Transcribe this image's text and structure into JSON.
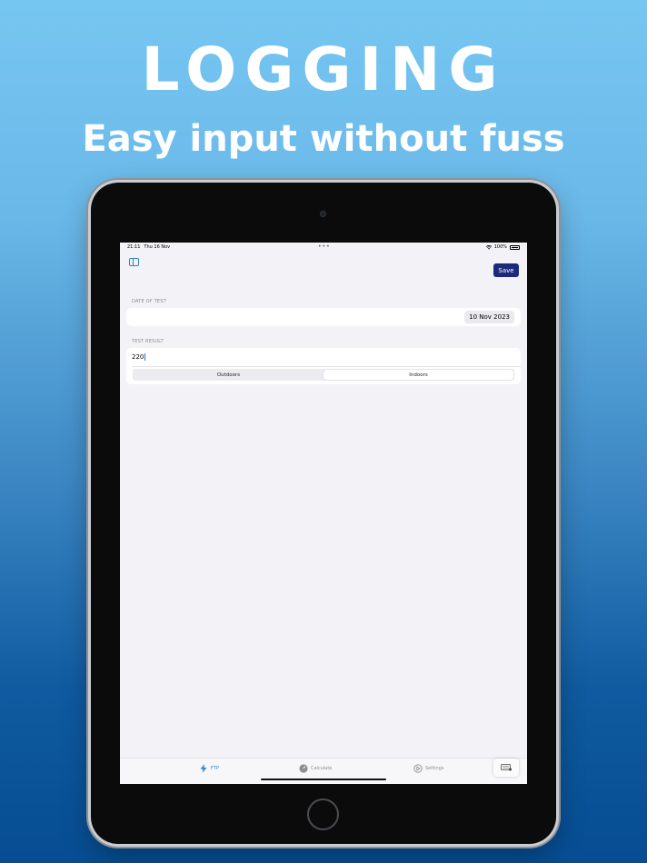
{
  "headline": {
    "title": "LOGGING",
    "subtitle": "Easy input without fuss"
  },
  "status_bar": {
    "time": "21:11",
    "date": "Thu 16 Nov",
    "dots": "•••",
    "battery": "100%"
  },
  "nav": {
    "save_label": "Save"
  },
  "form": {
    "date_section_header": "DATE OF TEST",
    "date_value": "10 Nov 2023",
    "result_section_header": "TEST RESULT",
    "result_value": "220",
    "segments": [
      {
        "label": "Outdoors",
        "selected": false
      },
      {
        "label": "Indoors",
        "selected": true
      }
    ]
  },
  "tab_bar": {
    "tabs": [
      {
        "label": "FTP",
        "icon": "bolt-icon",
        "active": true
      },
      {
        "label": "Calculate",
        "icon": "gauge-icon",
        "active": false
      },
      {
        "label": "Settings",
        "icon": "settings-icon",
        "active": false
      }
    ]
  },
  "colors": {
    "accent": "#2f80c8",
    "save_button": "#1c2a7e",
    "background": "#f2f2f7"
  }
}
